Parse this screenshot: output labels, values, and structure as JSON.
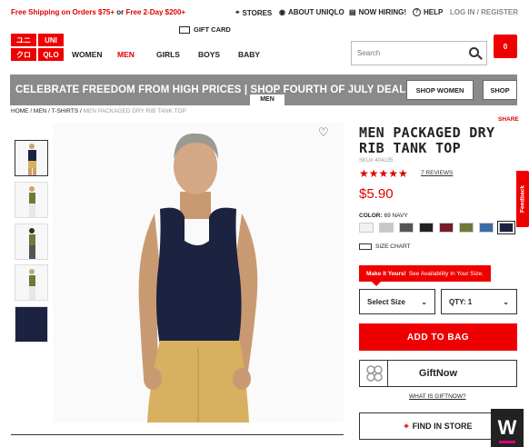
{
  "topbar": {
    "promo_free": "Free Shipping on Orders $75+",
    "promo_or": "or",
    "promo_2day": "Free 2-Day $200+",
    "stores": "STORES",
    "about": "ABOUT UNIQLO",
    "hiring": "NOW HIRING!",
    "help": "HELP",
    "account": "LOG IN / REGISTER"
  },
  "header": {
    "logo": [
      "ユニ",
      "UNI",
      "クロ",
      "QLO"
    ],
    "gift_card": "GIFT CARD",
    "nav": [
      "WOMEN",
      "MEN",
      "GIRLS",
      "BOYS",
      "BABY"
    ],
    "active_nav": "MEN",
    "search_placeholder": "Search",
    "cart_count": "0"
  },
  "banner": {
    "text": "CELEBRATE FREEDOM FROM HIGH PRICES | SHOP FOURTH OF JULY DEALS NOW",
    "btn_women": "SHOP WOMEN",
    "btn_men": "SHOP",
    "men_tag": "MEN"
  },
  "breadcrumb": {
    "home": "HOME",
    "men": "MEN",
    "tshirts": "T-SHIRTS",
    "current": "MEN PACKAGED DRY RIB TANK TOP"
  },
  "share": "SHARE",
  "product": {
    "title": "MEN PACKAGED DRY RIB TANK TOP",
    "sku": "SKU# 404135",
    "rating": 4.5,
    "stars": "★★★★★",
    "reviews": "7 REVIEWS",
    "price": "$5.90",
    "color_label": "COLOR:",
    "color_value": "69 NAVY",
    "swatches": [
      "#f2f2ee",
      "#c8c8c4",
      "#555555",
      "#222222",
      "#7a1a2a",
      "#6e7a3a",
      "#3d6aa6",
      "#1c2340"
    ],
    "size_chart": "SIZE CHART",
    "warn_bold": "Make It Yours!",
    "warn_text": "See Availability In Your Size.",
    "select_size": "Select Size",
    "qty": "QTY: 1",
    "add_to_bag": "ADD TO BAG",
    "giftnow": "GiftNow",
    "what_giftnow": "WHAT IS GIFTNOW?",
    "find_store": "FIND IN STORE"
  },
  "feedback": "Feedback",
  "watermark": "W",
  "colors": {
    "brand": "#e00000",
    "banner": "#8a8a8a"
  }
}
